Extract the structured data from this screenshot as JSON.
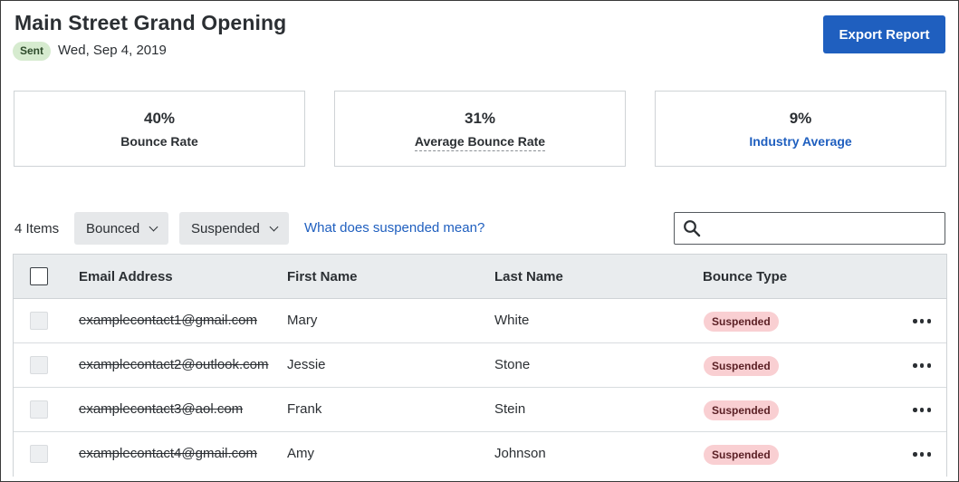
{
  "page": {
    "title": "Main Street Grand Opening",
    "status_badge": "Sent",
    "date": "Wed, Sep 4, 2019",
    "export_label": "Export Report"
  },
  "stats": [
    {
      "value": "40%",
      "label": "Bounce Rate"
    },
    {
      "value": "31%",
      "label": "Average Bounce Rate"
    },
    {
      "value": "9%",
      "label": "Industry Average"
    }
  ],
  "toolbar": {
    "items_count": "4 Items",
    "filter_bounced": "Bounced",
    "filter_suspended": "Suspended",
    "help_link": "What does suspended mean?",
    "search_placeholder": ""
  },
  "table": {
    "columns": [
      "Email Address",
      "First Name",
      "Last Name",
      "Bounce Type"
    ],
    "rows": [
      {
        "email": "examplecontact1@gmail.com",
        "first": "Mary",
        "last": "White",
        "bounce": "Suspended"
      },
      {
        "email": "examplecontact2@outlook.com",
        "first": "Jessie",
        "last": "Stone",
        "bounce": "Suspended"
      },
      {
        "email": "examplecontact3@aol.com",
        "first": "Frank",
        "last": "Stein",
        "bounce": "Suspended"
      },
      {
        "email": "examplecontact4@gmail.com",
        "first": "Amy",
        "last": "Johnson",
        "bounce": "Suspended"
      }
    ]
  },
  "icons": {
    "search": "search-icon",
    "chevron": "chevron-down-icon",
    "more": "more-horizontal-icon"
  },
  "colors": {
    "primary": "#1f5fbf",
    "sent_badge": "#d6ebcf",
    "suspended_badge": "#f9cfd2"
  }
}
